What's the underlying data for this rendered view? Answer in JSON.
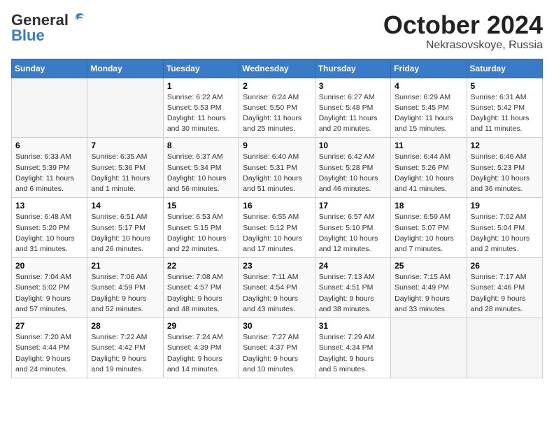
{
  "header": {
    "logo_general": "General",
    "logo_blue": "Blue",
    "month": "October 2024",
    "location": "Nekrasovskoye, Russia"
  },
  "weekdays": [
    "Sunday",
    "Monday",
    "Tuesday",
    "Wednesday",
    "Thursday",
    "Friday",
    "Saturday"
  ],
  "weeks": [
    [
      {
        "day": "",
        "info": ""
      },
      {
        "day": "",
        "info": ""
      },
      {
        "day": "1",
        "info": "Sunrise: 6:22 AM\nSunset: 5:53 PM\nDaylight: 11 hours\nand 30 minutes."
      },
      {
        "day": "2",
        "info": "Sunrise: 6:24 AM\nSunset: 5:50 PM\nDaylight: 11 hours\nand 25 minutes."
      },
      {
        "day": "3",
        "info": "Sunrise: 6:27 AM\nSunset: 5:48 PM\nDaylight: 11 hours\nand 20 minutes."
      },
      {
        "day": "4",
        "info": "Sunrise: 6:29 AM\nSunset: 5:45 PM\nDaylight: 11 hours\nand 15 minutes."
      },
      {
        "day": "5",
        "info": "Sunrise: 6:31 AM\nSunset: 5:42 PM\nDaylight: 11 hours\nand 11 minutes."
      }
    ],
    [
      {
        "day": "6",
        "info": "Sunrise: 6:33 AM\nSunset: 5:39 PM\nDaylight: 11 hours\nand 6 minutes."
      },
      {
        "day": "7",
        "info": "Sunrise: 6:35 AM\nSunset: 5:36 PM\nDaylight: 11 hours\nand 1 minute."
      },
      {
        "day": "8",
        "info": "Sunrise: 6:37 AM\nSunset: 5:34 PM\nDaylight: 10 hours\nand 56 minutes."
      },
      {
        "day": "9",
        "info": "Sunrise: 6:40 AM\nSunset: 5:31 PM\nDaylight: 10 hours\nand 51 minutes."
      },
      {
        "day": "10",
        "info": "Sunrise: 6:42 AM\nSunset: 5:28 PM\nDaylight: 10 hours\nand 46 minutes."
      },
      {
        "day": "11",
        "info": "Sunrise: 6:44 AM\nSunset: 5:26 PM\nDaylight: 10 hours\nand 41 minutes."
      },
      {
        "day": "12",
        "info": "Sunrise: 6:46 AM\nSunset: 5:23 PM\nDaylight: 10 hours\nand 36 minutes."
      }
    ],
    [
      {
        "day": "13",
        "info": "Sunrise: 6:48 AM\nSunset: 5:20 PM\nDaylight: 10 hours\nand 31 minutes."
      },
      {
        "day": "14",
        "info": "Sunrise: 6:51 AM\nSunset: 5:17 PM\nDaylight: 10 hours\nand 26 minutes."
      },
      {
        "day": "15",
        "info": "Sunrise: 6:53 AM\nSunset: 5:15 PM\nDaylight: 10 hours\nand 22 minutes."
      },
      {
        "day": "16",
        "info": "Sunrise: 6:55 AM\nSunset: 5:12 PM\nDaylight: 10 hours\nand 17 minutes."
      },
      {
        "day": "17",
        "info": "Sunrise: 6:57 AM\nSunset: 5:10 PM\nDaylight: 10 hours\nand 12 minutes."
      },
      {
        "day": "18",
        "info": "Sunrise: 6:59 AM\nSunset: 5:07 PM\nDaylight: 10 hours\nand 7 minutes."
      },
      {
        "day": "19",
        "info": "Sunrise: 7:02 AM\nSunset: 5:04 PM\nDaylight: 10 hours\nand 2 minutes."
      }
    ],
    [
      {
        "day": "20",
        "info": "Sunrise: 7:04 AM\nSunset: 5:02 PM\nDaylight: 9 hours\nand 57 minutes."
      },
      {
        "day": "21",
        "info": "Sunrise: 7:06 AM\nSunset: 4:59 PM\nDaylight: 9 hours\nand 52 minutes."
      },
      {
        "day": "22",
        "info": "Sunrise: 7:08 AM\nSunset: 4:57 PM\nDaylight: 9 hours\nand 48 minutes."
      },
      {
        "day": "23",
        "info": "Sunrise: 7:11 AM\nSunset: 4:54 PM\nDaylight: 9 hours\nand 43 minutes."
      },
      {
        "day": "24",
        "info": "Sunrise: 7:13 AM\nSunset: 4:51 PM\nDaylight: 9 hours\nand 38 minutes."
      },
      {
        "day": "25",
        "info": "Sunrise: 7:15 AM\nSunset: 4:49 PM\nDaylight: 9 hours\nand 33 minutes."
      },
      {
        "day": "26",
        "info": "Sunrise: 7:17 AM\nSunset: 4:46 PM\nDaylight: 9 hours\nand 28 minutes."
      }
    ],
    [
      {
        "day": "27",
        "info": "Sunrise: 7:20 AM\nSunset: 4:44 PM\nDaylight: 9 hours\nand 24 minutes."
      },
      {
        "day": "28",
        "info": "Sunrise: 7:22 AM\nSunset: 4:42 PM\nDaylight: 9 hours\nand 19 minutes."
      },
      {
        "day": "29",
        "info": "Sunrise: 7:24 AM\nSunset: 4:39 PM\nDaylight: 9 hours\nand 14 minutes."
      },
      {
        "day": "30",
        "info": "Sunrise: 7:27 AM\nSunset: 4:37 PM\nDaylight: 9 hours\nand 10 minutes."
      },
      {
        "day": "31",
        "info": "Sunrise: 7:29 AM\nSunset: 4:34 PM\nDaylight: 9 hours\nand 5 minutes."
      },
      {
        "day": "",
        "info": ""
      },
      {
        "day": "",
        "info": ""
      }
    ]
  ]
}
